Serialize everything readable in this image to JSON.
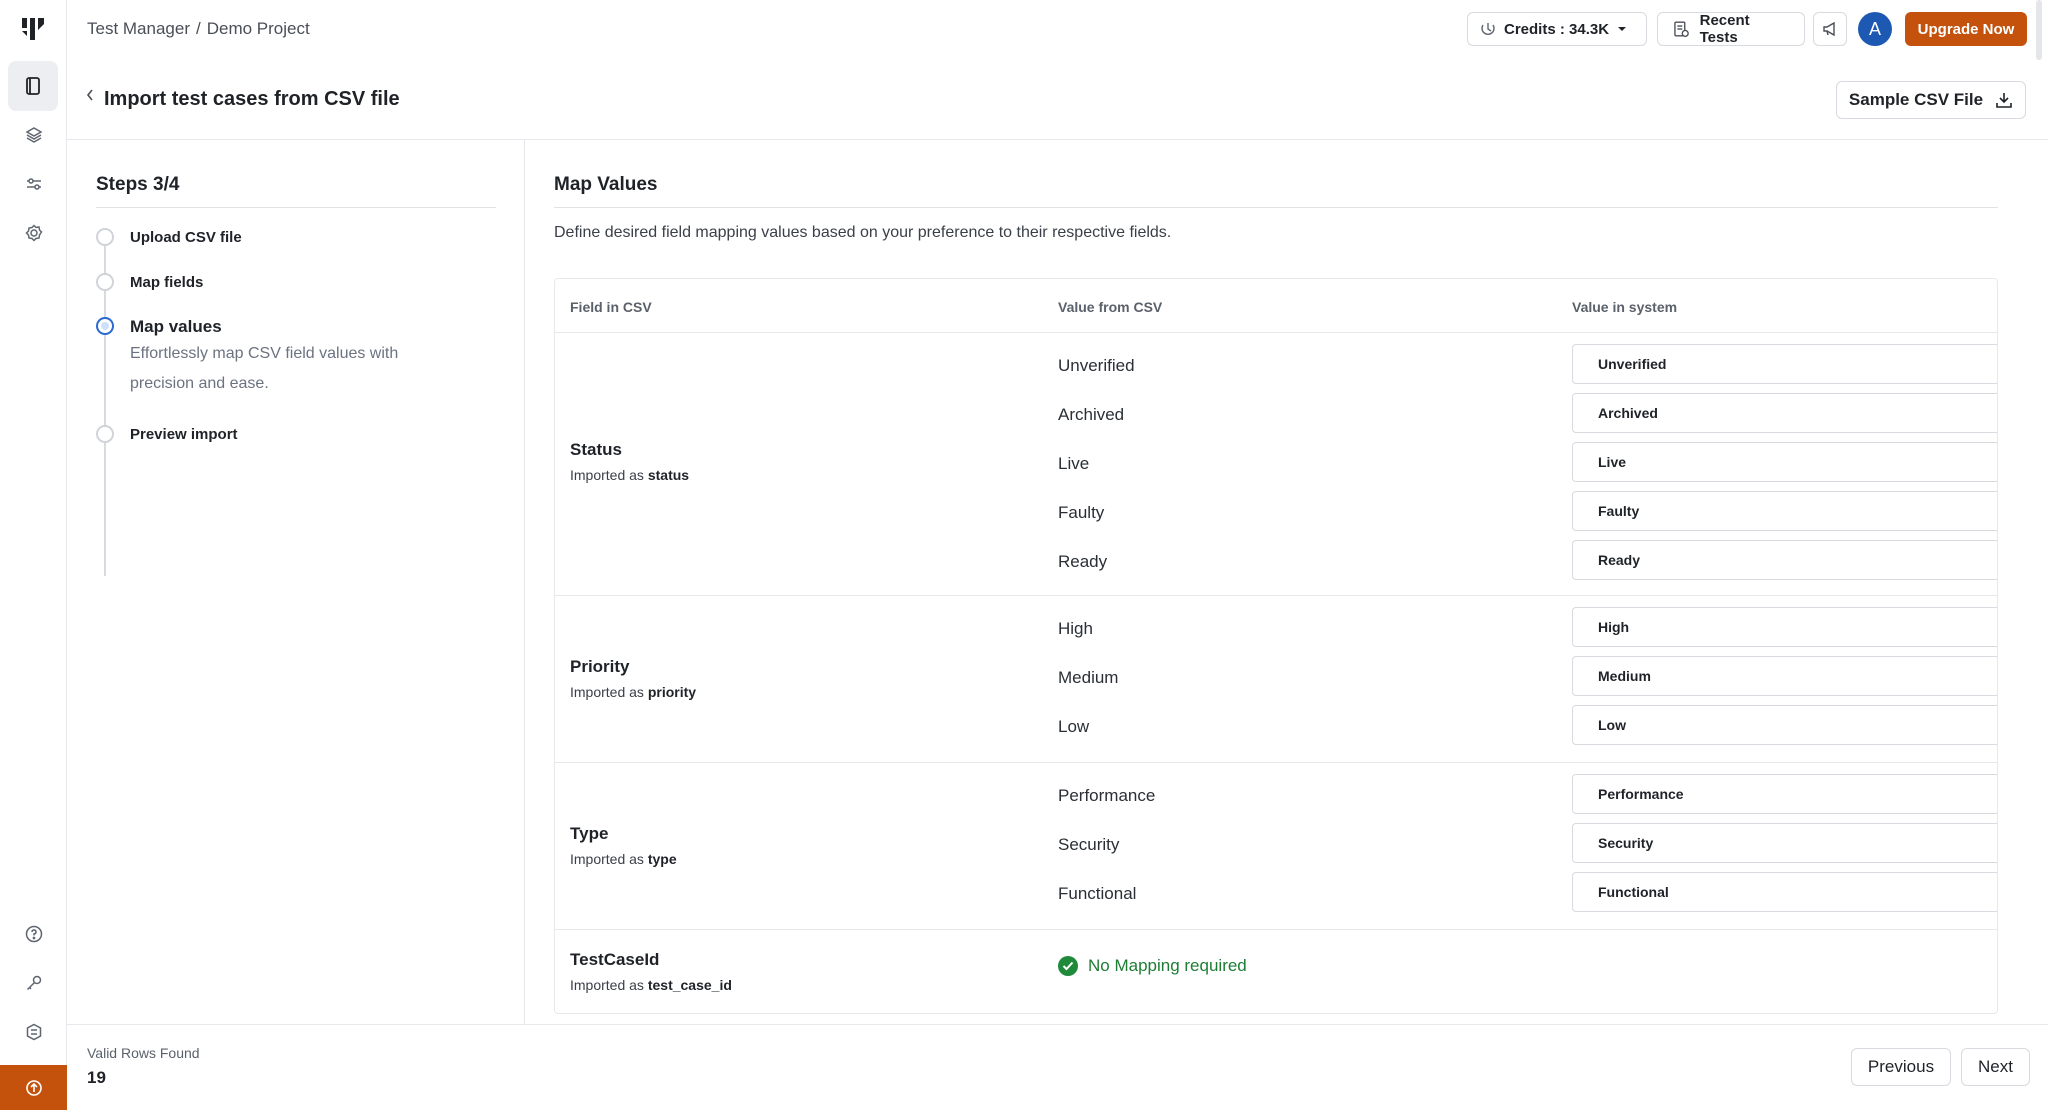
{
  "header": {
    "breadcrumb": [
      "Test Manager",
      "/",
      "Demo Project"
    ],
    "credits_label": "Credits : 34.3K",
    "recent_tests_label": "Recent Tests",
    "avatar_initial": "A",
    "upgrade_label": "Upgrade Now"
  },
  "page": {
    "title": "Import test cases from CSV file",
    "sample_csv_label": "Sample CSV File"
  },
  "steps": {
    "title": "Steps 3/4",
    "items": [
      {
        "label": "Upload CSV file"
      },
      {
        "label": "Map fields"
      },
      {
        "label": "Map values",
        "description": "Effortlessly map CSV field values with precision and ease."
      },
      {
        "label": "Preview import"
      }
    ]
  },
  "main": {
    "title": "Map Values",
    "description": "Define desired field mapping values based on your preference to their respective fields.",
    "columns": [
      "Field in CSV",
      "Value from CSV",
      "Value in system"
    ],
    "imported_as_prefix": "Imported as",
    "groups": [
      {
        "field": "Status",
        "imported_as": "status",
        "rows": [
          {
            "csv": "Unverified",
            "system": "Unverified"
          },
          {
            "csv": "Archived",
            "system": "Archived"
          },
          {
            "csv": "Live",
            "system": "Live"
          },
          {
            "csv": "Faulty",
            "system": "Faulty"
          },
          {
            "csv": "Ready",
            "system": "Ready"
          }
        ]
      },
      {
        "field": "Priority",
        "imported_as": "priority",
        "rows": [
          {
            "csv": "High",
            "system": "High"
          },
          {
            "csv": "Medium",
            "system": "Medium"
          },
          {
            "csv": "Low",
            "system": "Low"
          }
        ]
      },
      {
        "field": "Type",
        "imported_as": "type",
        "rows": [
          {
            "csv": "Performance",
            "system": "Performance"
          },
          {
            "csv": "Security",
            "system": "Security"
          },
          {
            "csv": "Functional",
            "system": "Functional"
          }
        ]
      },
      {
        "field": "TestCaseId",
        "imported_as": "test_case_id",
        "no_mapping": "No Mapping required"
      }
    ]
  },
  "footer": {
    "valid_rows_label": "Valid Rows Found",
    "valid_rows_count": "19",
    "previous_label": "Previous",
    "next_label": "Next"
  },
  "colors": {
    "accent": "#c4520d",
    "avatar": "#1d59b3",
    "active_step": "#2a6ad2",
    "success": "#1f8a39"
  }
}
